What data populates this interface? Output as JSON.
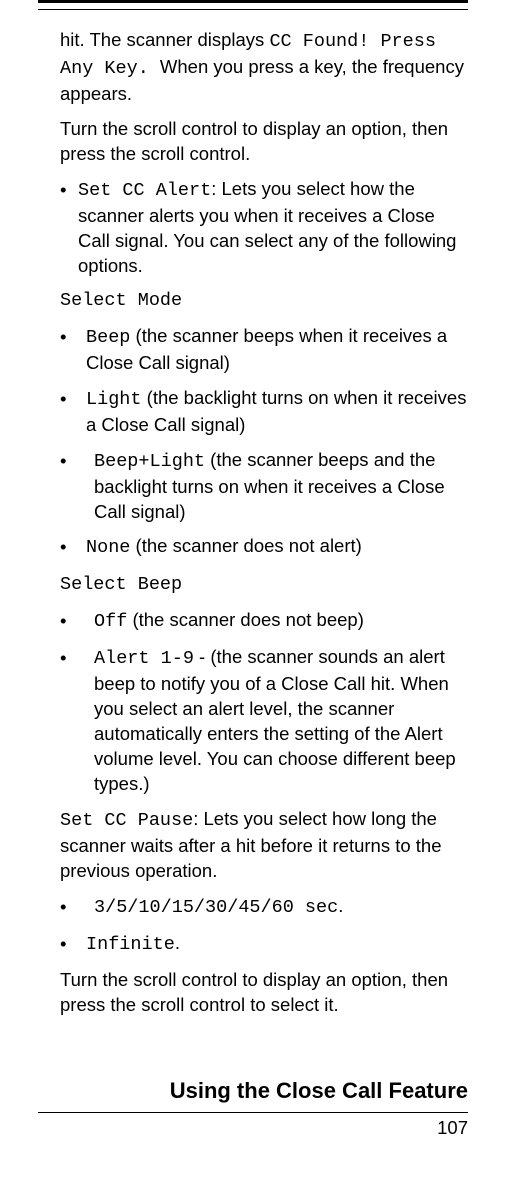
{
  "content": {
    "intro1_pre": "hit. The scanner displays ",
    "intro1_code": "CC Found! Press Any Key. ",
    "intro1_post": " When you press a key, the frequency appears.",
    "intro2": "Turn the scroll control to display an option, then press the scroll control.",
    "setcc_code": "Set CC Alert",
    "setcc_text": ": Lets you select how the scanner alerts you when it receives a Close Call signal. You can select any of the following options.",
    "select_mode": "Select Mode",
    "beep_code": "Beep",
    "beep_text": " (the scanner beeps when it receives a Close Call signal)",
    "light_code": "Light",
    "light_text": " (the backlight turns on when it receives a Close Call signal)",
    "beeplight_code": "Beep+Light",
    "beeplight_text": " (the scanner beeps and the backlight turns on when it receives a Close Call signal)",
    "none_code": "None",
    "none_text": " (the scanner does not alert)",
    "select_beep": "Select Beep",
    "off_code": "Off",
    "off_text": " (the scanner does not beep)",
    "alert_code": "Alert 1-9",
    "alert_text": " - (the scanner sounds an alert beep to notify you of a Close Call hit. When you select an alert level, the scanner automatically enters the setting of the Alert volume level. You can choose different beep types.)",
    "setpause_code": "Set CC Pause",
    "setpause_text": ": Lets you select how long the scanner waits after a hit before it returns to the previous operation.",
    "sec_code": "3/5/10/15/30/45/60 sec",
    "sec_dot": ".",
    "infinite_code": "Infinite",
    "infinite_dot": ".",
    "turn_scroll": "Turn the scroll control to display an option, then press the scroll control to select it."
  },
  "footer": {
    "section": "Using the Close Call Feature",
    "pagenum": "107"
  }
}
